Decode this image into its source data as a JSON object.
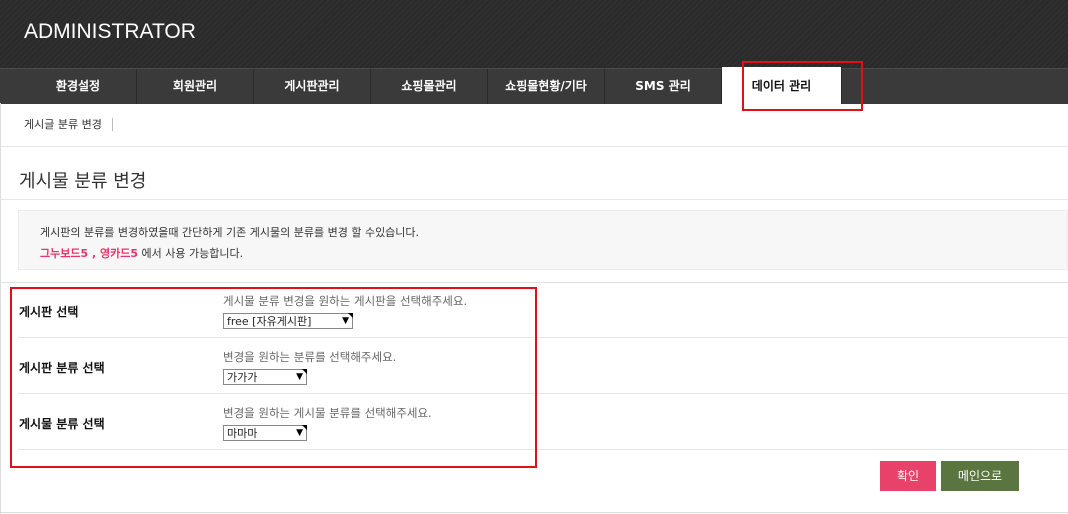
{
  "header": {
    "brand": "ADMINISTRATOR"
  },
  "nav": {
    "items": [
      {
        "label": "환경설정"
      },
      {
        "label": "회원관리"
      },
      {
        "label": "게시판관리"
      },
      {
        "label": "쇼핑몰관리"
      },
      {
        "label": "쇼핑몰현황/기타"
      },
      {
        "label": "SMS 관리"
      },
      {
        "label": "데이터 관리"
      }
    ],
    "active": "데이터 관리"
  },
  "subnav": {
    "items": [
      {
        "label": "게시글 분류 변경"
      }
    ]
  },
  "page": {
    "title": "게시물 분류 변경"
  },
  "info": {
    "line1": "게시판의 분류를 변경하였을때 간단하게 기존 게시물의 분류를 변경 할 수있습니다.",
    "highlight": "그누보드5 , 영카드5",
    "line2_rest": " 에서 사용 가능합니다."
  },
  "form": {
    "rows": [
      {
        "label": "게시판 선택",
        "help": "게시물 분류 변경을 원하는 게시판을 선택해주세요.",
        "value": "free [자유게시판]"
      },
      {
        "label": "게시판 분류 선택",
        "help": "변경을 원하는 분류를 선택해주세요.",
        "value": "가가가"
      },
      {
        "label": "게시물 분류 선택",
        "help": "변경을 원하는 게시물 분류를 선택해주세요.",
        "value": "마마마"
      }
    ]
  },
  "buttons": {
    "confirm": "확인",
    "main": "메인으로"
  },
  "colors": {
    "header_bg": "#2b2b2b",
    "nav_bg": "#3a3a3a",
    "highlight_border": "#e0101a",
    "accent_pink": "#e8336b",
    "confirm_button": "#e8416a",
    "main_button": "#5a7540"
  },
  "icons": {
    "select_arrow": "dropdown-arrow-icon"
  }
}
